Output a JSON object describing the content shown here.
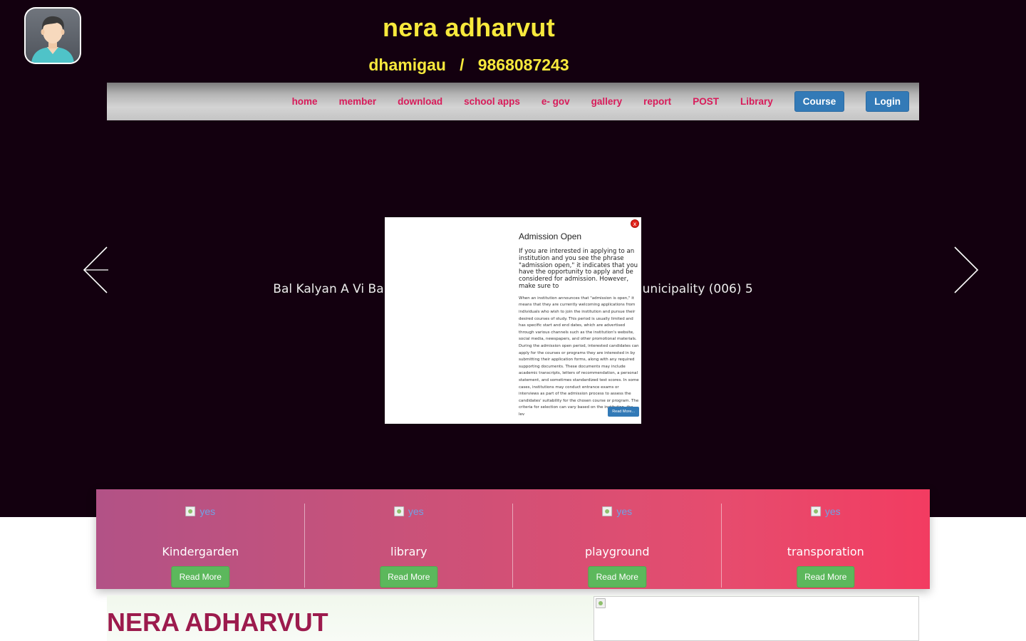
{
  "header": {
    "site_title": "nera adharvut",
    "location": "dhamigau",
    "separator": "/",
    "phone": "9868087243"
  },
  "nav": {
    "links": [
      "home",
      "member",
      "download",
      "school apps",
      "e- gov",
      "gallery",
      "report",
      "POST",
      "Library"
    ],
    "course_label": "Course",
    "login_label": "Login"
  },
  "slider": {
    "caption_left": "Bal Kalyan A Vi Balwan",
    "caption_right": "ral Municipality (006) 5"
  },
  "popup": {
    "close_label": "x",
    "title": "Admission Open",
    "lead": "If you are interested in applying to an institution and you see the phrase \"admission open,\" it indicates that you have the opportunity to apply and be considered for admission. However, make sure to",
    "body": "When an institution announces that \"admission is open,\" it means that they are currently welcoming applications from individuals who wish to join the institution and pursue their desired courses of study. This period is usually limited and has specific start and end dates, which are advertised through various channels such as the institution's website, social media, newspapers, and other promotional materials. During the admission open period, interested candidates can apply for the courses or programs they are interested in by submitting their application forms, along with any required supporting documents. These documents may include academic transcripts, letters of recommendation, a personal statement, and sometimes standardized test scores. In some cases, institutions may conduct entrance exams or interviews as part of the admission process to assess the candidates' suitability for the chosen course or program. The criteria for selection can vary based on the institution, the lev",
    "read_more": "Read More..."
  },
  "features": [
    {
      "image_alt": "yes",
      "title": "Kindergarden",
      "button": "Read More"
    },
    {
      "image_alt": "yes",
      "title": "library",
      "button": "Read More"
    },
    {
      "image_alt": "yes",
      "title": "playground",
      "button": "Read More"
    },
    {
      "image_alt": "yes",
      "title": "transporation",
      "button": "Read More"
    }
  ],
  "section": {
    "heading": "NERA ADHARVUT"
  },
  "colors": {
    "hero_bg": "#13000f",
    "title_yellow": "#f7e93c",
    "nav_link": "#d81b5a",
    "button_blue": "#337ab7",
    "button_green": "#5cb85c",
    "heading_maroon": "#9c1b4d"
  },
  "icons": {
    "avatar": "user-avatar-icon",
    "prev": "arrow-left-icon",
    "next": "arrow-right-icon",
    "close": "close-icon",
    "broken_image": "broken-image-icon"
  }
}
